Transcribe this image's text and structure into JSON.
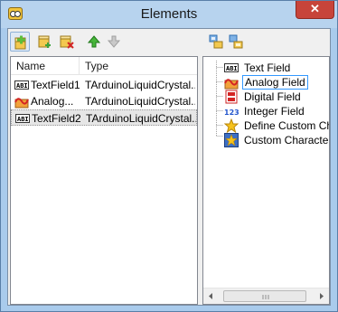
{
  "window": {
    "title": "Elements",
    "close_label": "✕"
  },
  "toolbar_left": {
    "buttons": [
      {
        "name": "add-element-button",
        "icon": "new-box-icon"
      },
      {
        "name": "add-child-button",
        "icon": "box-add-icon"
      },
      {
        "name": "delete-element-button",
        "icon": "box-delete-icon"
      },
      {
        "name": "move-up-button",
        "icon": "arrow-up-icon"
      },
      {
        "name": "move-down-button",
        "icon": "arrow-down-icon",
        "disabled": true
      }
    ]
  },
  "toolbar_right": {
    "buttons": [
      {
        "name": "expand-all-button",
        "icon": "expand-tree-icon"
      },
      {
        "name": "collapse-all-button",
        "icon": "collapse-tree-icon"
      }
    ]
  },
  "list": {
    "columns": [
      "Name",
      "Type"
    ],
    "rows": [
      {
        "name": "TextField1",
        "type": "TArduinoLiquidCrystal...",
        "icon": "text-field-icon"
      },
      {
        "name": "Analog...",
        "type": "TArduinoLiquidCrystal...",
        "icon": "analog-field-icon"
      },
      {
        "name": "TextField2",
        "type": "TArduinoLiquidCrystal...",
        "icon": "text-field-icon",
        "selected": true
      }
    ]
  },
  "tree": {
    "items": [
      {
        "label": "Text Field",
        "icon": "text-field-icon"
      },
      {
        "label": "Analog Field",
        "icon": "analog-field-icon",
        "selected": true
      },
      {
        "label": "Digital Field",
        "icon": "digital-field-icon"
      },
      {
        "label": "Integer Field",
        "icon": "integer-field-icon"
      },
      {
        "label": "Define Custom Chara",
        "icon": "define-custom-character-icon"
      },
      {
        "label": "Custom Character Fi",
        "icon": "custom-character-field-icon"
      }
    ]
  },
  "icon_text": {
    "text_field": "ABI",
    "integer": "123"
  },
  "colors": {
    "selection_border": "#3399ff",
    "close_button": "#c7443a",
    "title_bar": "#b7d3ee"
  }
}
